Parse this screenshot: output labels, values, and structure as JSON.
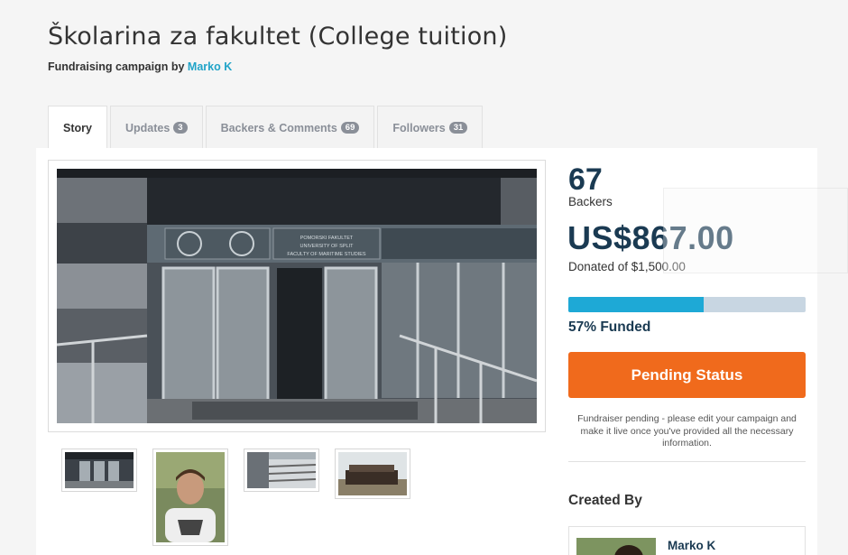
{
  "campaign": {
    "title": "Školarina za fakultet (College tuition)",
    "byline_prefix": "Fundraising campaign by",
    "creator": "Marko K"
  },
  "tabs": [
    {
      "label": "Story",
      "active": true
    },
    {
      "label": "Updates",
      "count": "3"
    },
    {
      "label": "Backers & Comments",
      "count": "69"
    },
    {
      "label": "Followers",
      "count": "31"
    }
  ],
  "stats": {
    "backers_count": "67",
    "backers_label": "Backers",
    "amount_raised": "US$867.00",
    "donated_of": "Donated of $1,500.00",
    "funded_fraction": 0.57,
    "funded_text": "57% Funded"
  },
  "status": {
    "button_label": "Pending Status",
    "note": "Fundraiser pending - please edit your campaign and make it live once you've provided all the necessary information."
  },
  "created_by": {
    "heading": "Created By",
    "name": "Marko K"
  },
  "building_sign": {
    "line1": "POMORSKI FAKULTET",
    "line2": "UNIVERSITY OF SPLIT",
    "line3": "FACULTY OF MARITIME STUDIES"
  },
  "colors": {
    "accent": "#21a4c8",
    "navy": "#1a3a52",
    "orange": "#f06a1c",
    "progress_track": "#c8d6e2",
    "progress_fill": "#1ea9d6"
  }
}
